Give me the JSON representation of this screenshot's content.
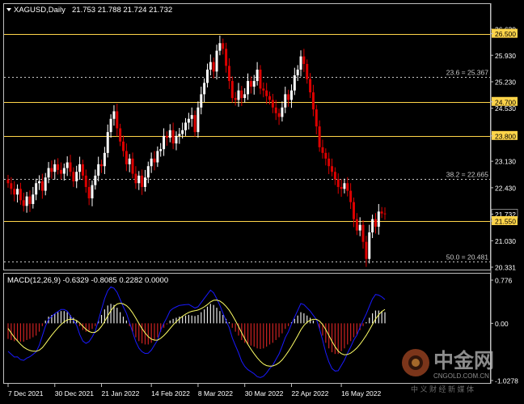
{
  "header": {
    "symbol_line": "XAGUSD,Daily",
    "ohlc": "21.753 21.788 21.724 21.732"
  },
  "price_axis": {
    "ticks": [
      "26.620",
      "26.500",
      "25.930",
      "25.230",
      "24.700",
      "24.530",
      "23.800",
      "23.130",
      "22.430",
      "21.732",
      "21.550",
      "21.030",
      "20.331"
    ],
    "highlighted": [
      "26.500",
      "24.700",
      "23.800",
      "21.550"
    ],
    "current": "21.732"
  },
  "levels": {
    "horizontal": [
      26.5,
      24.7,
      23.8,
      21.55
    ],
    "fibonacci": [
      {
        "label": "23.6 = 25.367",
        "value": 25.367
      },
      {
        "label": "38.2 = 22.665",
        "value": 22.665
      },
      {
        "label": "50.0 = 20.481",
        "value": 20.481
      }
    ]
  },
  "macd": {
    "title": "MACD(12,26,9) -0.6329 -0.8085 0.2282 0.0000",
    "axis_ticks": [
      "0.776",
      "0.00",
      "-1.0278"
    ]
  },
  "date_axis": [
    "7 Dec 2021",
    "30 Dec 2021",
    "21 Jan 2022",
    "14 Feb 2022",
    "8 Mar 2022",
    "30 Mar 2022",
    "22 Apr 2022",
    "16 May 2022"
  ],
  "watermark": {
    "brand": "中金网",
    "site": "CNGOLD.COM.CN",
    "slogan": "中 义 财 经 新 媒 体"
  },
  "colors": {
    "background": "#000000",
    "bull": "#ffffff",
    "bear": "#dd0000",
    "level": "#ffd54a",
    "fib": "#c8c8c8",
    "macd_line": "#1a1aff",
    "signal_line": "#ffff66"
  },
  "chart_data": {
    "type": "candlestick",
    "close": [
      22.55,
      22.4,
      22.25,
      22.4,
      22.1,
      21.95,
      22.2,
      22.0,
      22.25,
      22.55,
      22.6,
      22.35,
      22.7,
      22.95,
      22.85,
      23.05,
      22.9,
      22.8,
      22.95,
      23.1,
      22.85,
      22.6,
      22.85,
      23.05,
      22.75,
      22.45,
      22.15,
      22.5,
      22.75,
      23.05,
      23.0,
      23.35,
      23.9,
      24.25,
      24.45,
      24.0,
      23.65,
      23.4,
      23.05,
      23.2,
      22.8,
      22.55,
      22.75,
      22.45,
      22.7,
      23.0,
      23.2,
      23.1,
      23.4,
      23.45,
      23.8,
      23.75,
      23.95,
      23.6,
      23.8,
      23.85,
      23.95,
      24.15,
      24.25,
      24.35,
      23.9,
      24.55,
      24.9,
      25.2,
      25.55,
      25.75,
      25.5,
      26.05,
      26.25,
      26.1,
      25.65,
      25.25,
      24.8,
      24.75,
      25.0,
      24.8,
      24.9,
      25.25,
      25.1,
      25.25,
      25.55,
      25.05,
      25.0,
      24.85,
      24.75,
      24.55,
      24.4,
      24.3,
      24.55,
      24.9,
      24.75,
      25.0,
      25.4,
      25.55,
      25.9,
      25.7,
      25.3,
      24.95,
      24.5,
      24.05,
      23.5,
      23.35,
      23.2,
      23.0,
      22.85,
      22.65,
      22.45,
      22.4,
      22.55,
      22.35,
      22.05,
      21.6,
      21.3,
      21.45,
      21.0,
      20.55,
      21.25,
      21.6,
      21.4,
      21.8,
      21.75,
      21.732
    ],
    "macd_hist": [
      -0.28,
      -0.3,
      -0.32,
      -0.31,
      -0.33,
      -0.33,
      -0.3,
      -0.28,
      -0.25,
      -0.22,
      -0.15,
      -0.05,
      0.05,
      0.12,
      0.15,
      0.18,
      0.2,
      0.22,
      0.22,
      0.2,
      0.15,
      0.1,
      0.05,
      -0.05,
      -0.12,
      -0.15,
      -0.14,
      -0.1,
      -0.05,
      0.05,
      0.15,
      0.25,
      0.32,
      0.35,
      0.33,
      0.28,
      0.2,
      0.12,
      0.05,
      -0.05,
      -0.15,
      -0.25,
      -0.32,
      -0.36,
      -0.38,
      -0.38,
      -0.35,
      -0.3,
      -0.25,
      -0.15,
      -0.08,
      -0.02,
      0.05,
      0.08,
      0.1,
      0.12,
      0.13,
      0.14,
      0.15,
      0.14,
      0.13,
      0.15,
      0.2,
      0.25,
      0.3,
      0.35,
      0.33,
      0.28,
      0.22,
      0.15,
      0.08,
      0.02,
      -0.08,
      -0.15,
      -0.22,
      -0.3,
      -0.35,
      -0.38,
      -0.4,
      -0.42,
      -0.45,
      -0.46,
      -0.45,
      -0.42,
      -0.38,
      -0.35,
      -0.3,
      -0.25,
      -0.18,
      -0.1,
      -0.05,
      0.02,
      0.08,
      0.14,
      0.2,
      0.18,
      0.14,
      0.1,
      0.05,
      0.0,
      -0.1,
      -0.22,
      -0.35,
      -0.45,
      -0.52,
      -0.55,
      -0.55,
      -0.5,
      -0.45,
      -0.38,
      -0.32,
      -0.25,
      -0.2,
      -0.12,
      -0.05,
      0.02,
      0.1,
      0.18,
      0.23,
      0.23,
      0.22,
      0.2
    ]
  }
}
